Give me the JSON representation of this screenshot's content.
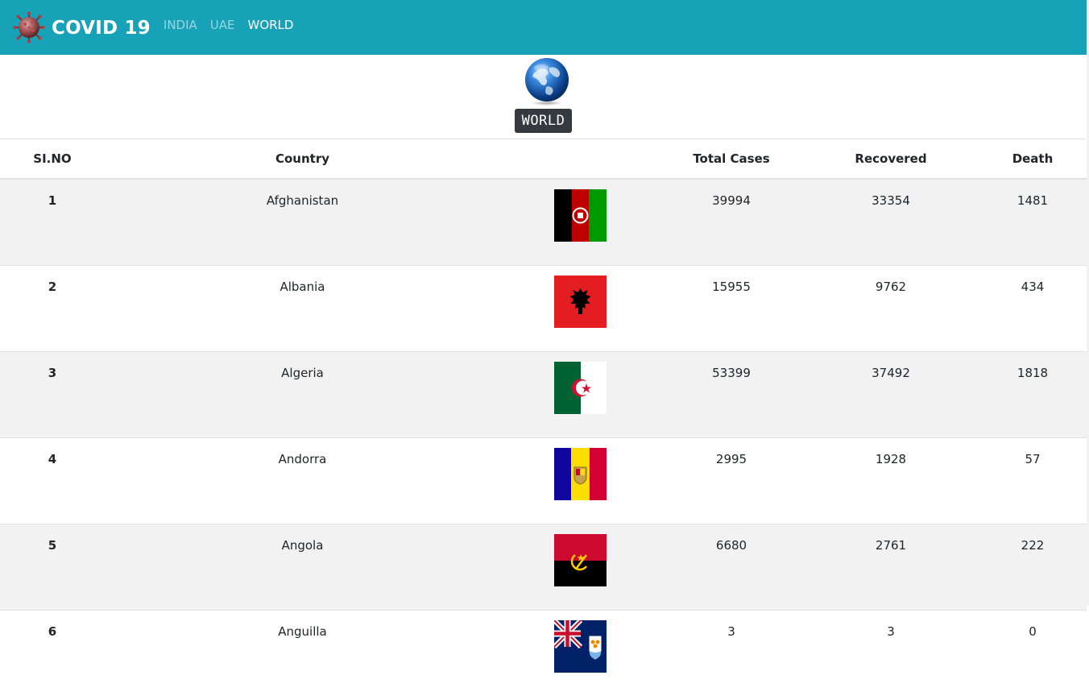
{
  "navbar": {
    "brand": "COVID 19",
    "links": [
      {
        "label": "INDIA",
        "active": false
      },
      {
        "label": "UAE",
        "active": false
      },
      {
        "label": "WORLD",
        "active": true
      }
    ]
  },
  "hero": {
    "globe_icon": "globe-icon",
    "label": "WORLD"
  },
  "table": {
    "headers": [
      "SI.NO",
      "Country",
      "",
      "Total Cases",
      "Recovered",
      "Death"
    ],
    "rows": [
      {
        "si": "1",
        "country": "Afghanistan",
        "flag": "afghanistan-flag",
        "total": "39994",
        "recovered": "33354",
        "death": "1481"
      },
      {
        "si": "2",
        "country": "Albania",
        "flag": "albania-flag",
        "total": "15955",
        "recovered": "9762",
        "death": "434"
      },
      {
        "si": "3",
        "country": "Algeria",
        "flag": "algeria-flag",
        "total": "53399",
        "recovered": "37492",
        "death": "1818"
      },
      {
        "si": "4",
        "country": "Andorra",
        "flag": "andorra-flag",
        "total": "2995",
        "recovered": "1928",
        "death": "57"
      },
      {
        "si": "5",
        "country": "Angola",
        "flag": "angola-flag",
        "total": "6680",
        "recovered": "2761",
        "death": "222"
      },
      {
        "si": "6",
        "country": "Anguilla",
        "flag": "anguilla-flag",
        "total": "3",
        "recovered": "3",
        "death": "0"
      }
    ]
  },
  "colors": {
    "navbar": "#17a2b8",
    "stripe": "#f2f2f2",
    "badge": "#343a40"
  }
}
